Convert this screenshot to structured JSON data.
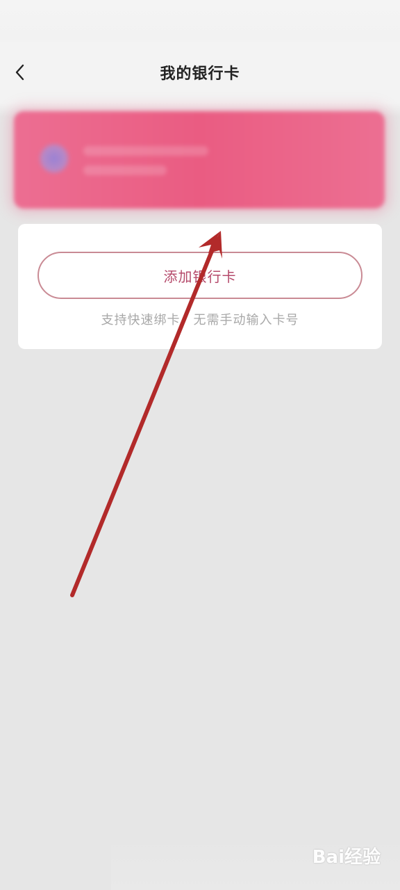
{
  "header": {
    "title": "我的银行卡",
    "back_icon": "chevron-left-icon"
  },
  "bank_card": {
    "color": "#ea5c82"
  },
  "add_card": {
    "button_label": "添加银行卡",
    "hint": "支持快速绑卡，无需手动输入卡号"
  },
  "annotation": {
    "arrow_color": "#b22a2a"
  },
  "watermark": {
    "text": "Bai经验"
  }
}
